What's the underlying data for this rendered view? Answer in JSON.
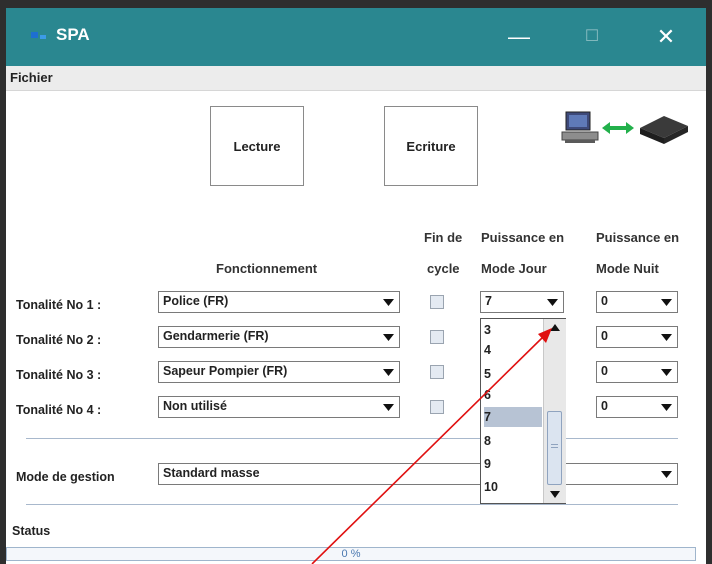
{
  "window": {
    "title": "SPA",
    "controls": {
      "minimize": "—",
      "maximize": "☐",
      "close": "✕"
    }
  },
  "menu": {
    "items": [
      {
        "label": "Fichier"
      }
    ]
  },
  "toolbar": {
    "read_label": "Lecture",
    "write_label": "Ecriture"
  },
  "icons": {
    "connection": "computer-to-device-connection-icon",
    "accent": "#2a8790"
  },
  "headers": {
    "fonctionnement": "Fonctionnement",
    "fin_de_line1": "Fin de",
    "fin_de_line2": "cycle",
    "jour_line1": "Puissance en",
    "jour_line2": "Mode Jour",
    "nuit_line1": "Puissance en",
    "nuit_line2": "Mode Nuit"
  },
  "rows": [
    {
      "label": "Tonalité No 1 :",
      "fonctionnement": "Police (FR)",
      "fin_de_cycle": false,
      "jour": "7",
      "nuit": "0"
    },
    {
      "label": "Tonalité No 2 :",
      "fonctionnement": "Gendarmerie (FR)",
      "fin_de_cycle": false,
      "jour": "",
      "nuit": "0"
    },
    {
      "label": "Tonalité No 3 :",
      "fonctionnement": "Sapeur Pompier (FR)",
      "fin_de_cycle": false,
      "jour": "",
      "nuit": "0"
    },
    {
      "label": "Tonalité No 4 :",
      "fonctionnement": "Non utilisé",
      "fin_de_cycle": false,
      "jour": "",
      "nuit": "0"
    }
  ],
  "dropdown": {
    "options": [
      "3",
      "4",
      "5",
      "6",
      "7",
      "8",
      "9",
      "10"
    ],
    "selected": "7"
  },
  "mode_gestion": {
    "label": "Mode de gestion",
    "value": "Standard masse"
  },
  "status": {
    "label": "Status",
    "progress_text": "0 %",
    "progress_value": 0
  }
}
